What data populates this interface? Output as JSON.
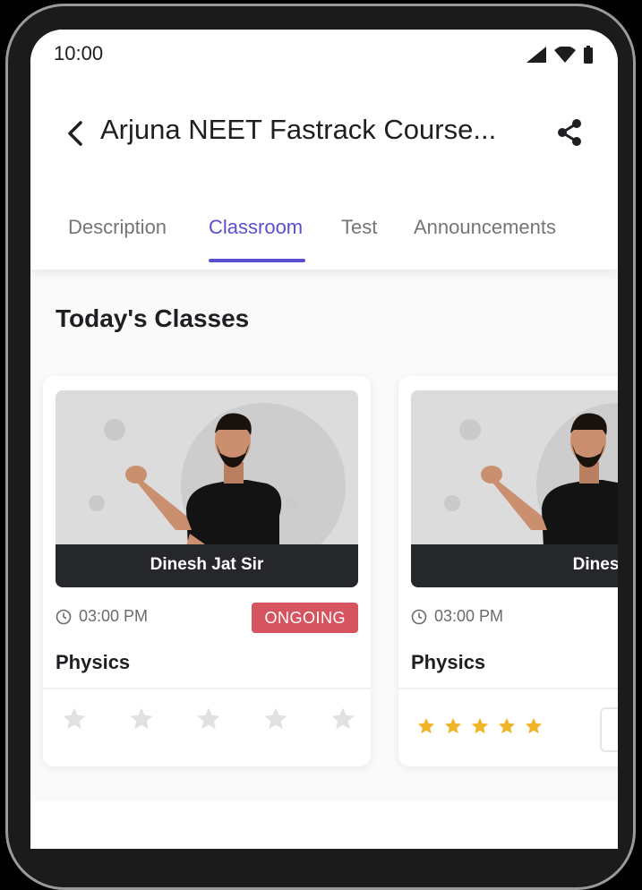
{
  "status_bar": {
    "time": "10:00",
    "icons": [
      "signal-icon",
      "wifi-icon",
      "battery-icon"
    ]
  },
  "header": {
    "title": "Arjuna NEET Fastrack Course...",
    "back_icon": "back-arrow-icon",
    "share_icon": "share-icon"
  },
  "tabs": [
    {
      "label": "Description",
      "active": false
    },
    {
      "label": "Classroom",
      "active": true
    },
    {
      "label": "Test",
      "active": false
    },
    {
      "label": "Announcements",
      "active": false
    }
  ],
  "section": {
    "title": "Today's Classes"
  },
  "cards": [
    {
      "teacher": "Dinesh Jat Sir",
      "time": "03:00 PM",
      "status": "ONGOING",
      "subject": "Physics",
      "rating": 0
    },
    {
      "teacher": "Dinesh Jat Sir",
      "time": "03:00 PM",
      "status": "",
      "subject": "Physics",
      "rating": 5
    }
  ],
  "colors": {
    "accent": "#5a4fcf",
    "badge": "#d6545f",
    "star_filled": "#f0b429",
    "star_empty": "#e1e1e1"
  }
}
